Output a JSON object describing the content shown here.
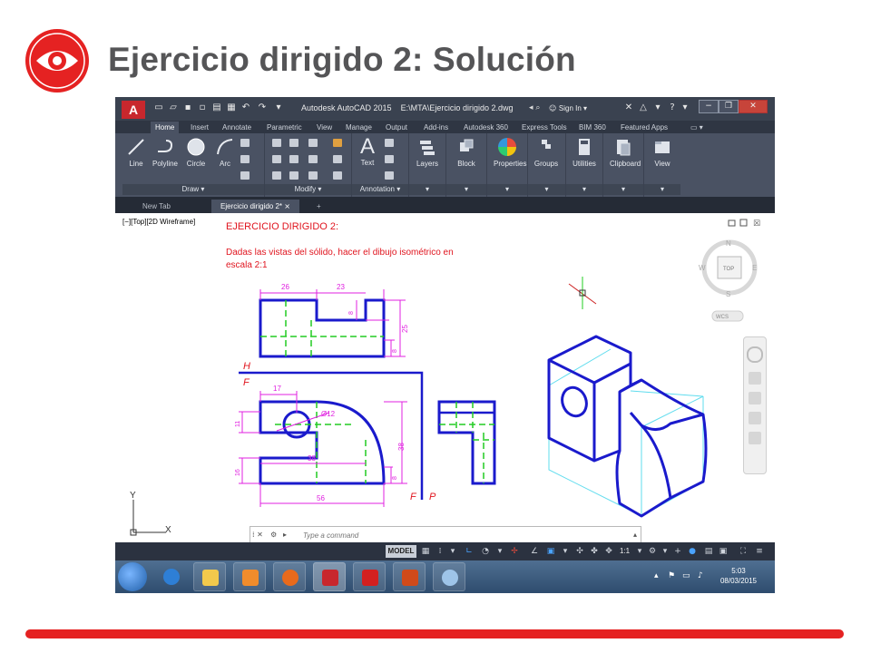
{
  "slide": {
    "title": "Ejercicio dirigido 2: Solución",
    "accent_color": "#e52222",
    "logo_icon": "eye-icon"
  },
  "window": {
    "app_name": "Autodesk AutoCAD 2015",
    "file_path": "E:\\MTA\\Ejercicio dirigido 2.dwg",
    "signin_label": "Sign In",
    "app_button_letter": "A"
  },
  "ribbon": {
    "tabs": [
      "Home",
      "Insert",
      "Annotate",
      "Parametric",
      "View",
      "Manage",
      "Output",
      "Add-ins",
      "Autodesk 360",
      "Express Tools",
      "BIM 360",
      "Featured Apps"
    ],
    "active_tab": "Home",
    "draw": {
      "title": "Draw",
      "tools": [
        "Line",
        "Polyline",
        "Circle",
        "Arc"
      ]
    },
    "modify": {
      "title": "Modify"
    },
    "annotation": {
      "title": "Annotation",
      "tools": [
        "Text"
      ]
    },
    "big_tools": [
      "Layers",
      "Block",
      "Properties",
      "Groups",
      "Utilities",
      "Clipboard",
      "View"
    ]
  },
  "file_tabs": {
    "new_tab": "New Tab",
    "active": "Ejercicio dirigido 2*",
    "plus": "+"
  },
  "canvas": {
    "viewport_label": "[−][Top][2D Wireframe]",
    "drawing_title": "EJERCICIO DIRIGIDO 2:",
    "instruction_line1": "Dadas las vistas del sólido, hacer el dibujo isométrico en",
    "instruction_line2": "escala 2:1",
    "view_labels": {
      "h": "H",
      "f": "F",
      "f2": "F",
      "p": "P"
    },
    "dimensions": {
      "top_width_left": "26",
      "top_width_right": "23",
      "top_small": "8",
      "top_height": "25",
      "top_small2": "8",
      "front_17": "17",
      "front_11": "11",
      "front_diam": "Ø12",
      "front_38_right": "38",
      "front_38_bottom": "38",
      "front_16": "16",
      "front_8": "8",
      "front_56": "56"
    },
    "viewcube": {
      "n": "N",
      "s": "S",
      "e": "E",
      "w": "W",
      "top": "TOP",
      "wcs": "WCS"
    },
    "ucs": {
      "x": "X",
      "y": "Y"
    },
    "command_placeholder": "Type a command"
  },
  "status": {
    "model": "MODEL",
    "scale": "1:1"
  },
  "taskbar": {
    "time": "5:03",
    "date": "08/03/2015"
  },
  "colors": {
    "geometry": "#1a1acc",
    "hidden": "#22cc22",
    "dimension": "#e020e0",
    "annotation": "#e0141e",
    "isobox": "#5fdcee"
  }
}
